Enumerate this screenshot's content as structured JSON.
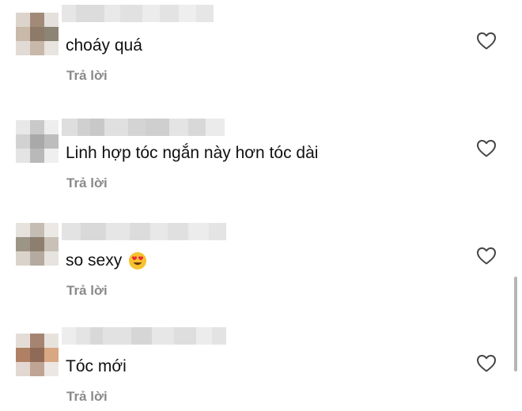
{
  "colors": {
    "text": "#111111",
    "reply": "#8a8a8a",
    "icon": "#444444",
    "scrollbar": "#b5b5b5"
  },
  "comments": [
    {
      "text": "choáy quá",
      "reply_label": "Trả lời",
      "icon": "heart-outline-icon"
    },
    {
      "text": "Linh hợp tóc ngắn này hơn tóc dài",
      "reply_label": "Trả lời",
      "icon": "heart-outline-icon"
    },
    {
      "text": "so sexy",
      "emoji": "heart-eyes-emoji",
      "reply_label": "Trả lời",
      "icon": "heart-outline-icon"
    },
    {
      "text": "Tóc mới",
      "reply_label": "Trả lời",
      "icon": "heart-outline-icon"
    }
  ]
}
